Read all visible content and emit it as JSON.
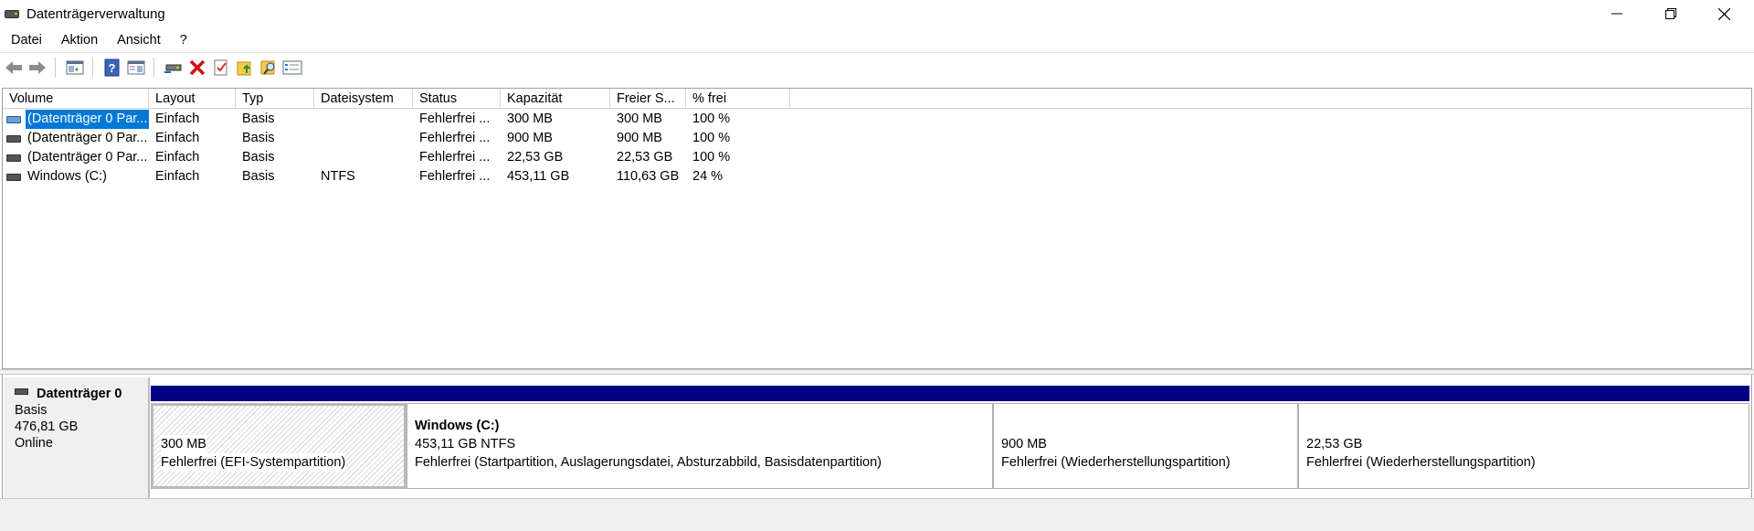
{
  "window": {
    "title": "Datenträgerverwaltung",
    "controls": {
      "minimize": "minimize-icon",
      "maximize": "restore-icon",
      "close": "close-icon"
    }
  },
  "menu": [
    "Datei",
    "Aktion",
    "Ansicht",
    "?"
  ],
  "toolbar": {
    "icons": [
      "back-icon",
      "forward-icon",
      "show-hide-console-tree-icon",
      "help-icon",
      "properties-view-icon",
      "connect-virtual-disk-icon",
      "delete-icon",
      "check-icon",
      "open-folder-icon",
      "explore-icon",
      "list-icon"
    ]
  },
  "volume_table": {
    "columns": [
      "Volume",
      "Layout",
      "Typ",
      "Dateisystem",
      "Status",
      "Kapazität",
      "Freier S...",
      "% frei"
    ],
    "rows": [
      {
        "volume": "(Datenträger 0 Par...",
        "layout": "Einfach",
        "typ": "Basis",
        "dateisystem": "",
        "status": "Fehlerfrei ...",
        "kapazitaet": "300 MB",
        "frei": "300 MB",
        "prozent": "100 %",
        "selected": true
      },
      {
        "volume": "(Datenträger 0 Par...",
        "layout": "Einfach",
        "typ": "Basis",
        "dateisystem": "",
        "status": "Fehlerfrei ...",
        "kapazitaet": "900 MB",
        "frei": "900 MB",
        "prozent": "100 %",
        "selected": false
      },
      {
        "volume": "(Datenträger 0 Par...",
        "layout": "Einfach",
        "typ": "Basis",
        "dateisystem": "",
        "status": "Fehlerfrei ...",
        "kapazitaet": "22,53 GB",
        "frei": "22,53 GB",
        "prozent": "100 %",
        "selected": false
      },
      {
        "volume": "Windows (C:)",
        "layout": "Einfach",
        "typ": "Basis",
        "dateisystem": "NTFS",
        "status": "Fehlerfrei ...",
        "kapazitaet": "453,11 GB",
        "frei": "110,63 GB",
        "prozent": "24 %",
        "selected": false
      }
    ]
  },
  "disk": {
    "name": "Datenträger 0",
    "type": "Basis",
    "size": "476,81 GB",
    "state": "Online",
    "partitions": [
      {
        "title": "",
        "size": "300 MB",
        "status": "Fehlerfrei (EFI-Systempartition)"
      },
      {
        "title": "Windows  (C:)",
        "size": "453,11 GB NTFS",
        "status": "Fehlerfrei (Startpartition, Auslagerungsdatei, Absturzabbild, Basisdatenpartition)"
      },
      {
        "title": "",
        "size": "900 MB",
        "status": "Fehlerfrei (Wiederherstellungspartition)"
      },
      {
        "title": "",
        "size": "22,53 GB",
        "status": "Fehlerfrei (Wiederherstellungspartition)"
      }
    ]
  },
  "colors": {
    "partition_bar": "#000080",
    "selection": "#0078d7"
  }
}
